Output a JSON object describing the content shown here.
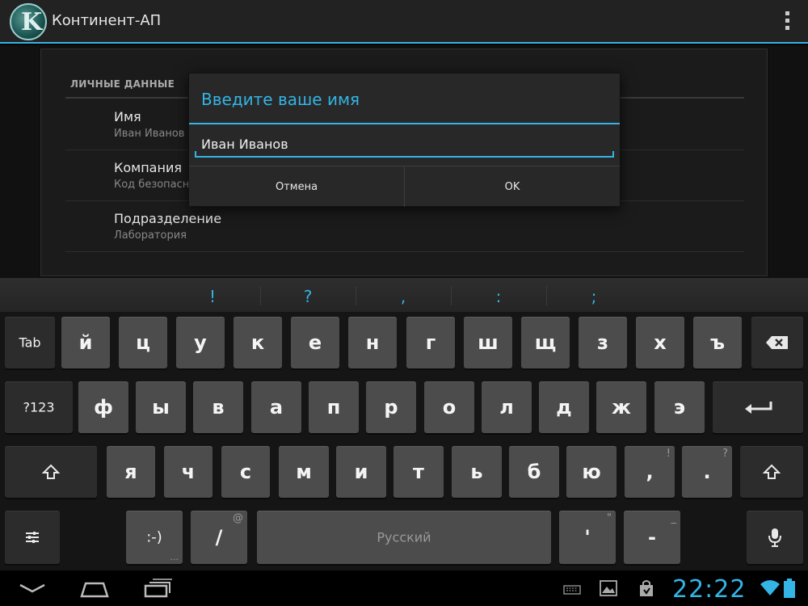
{
  "app": {
    "title": "Континент-АП",
    "icon_letter": "K"
  },
  "settings": {
    "section_header": "ЛИЧНЫЕ ДАННЫЕ",
    "items": [
      {
        "title": "Имя",
        "summary": "Иван Иванов"
      },
      {
        "title": "Компания",
        "summary": "Код безопасности"
      },
      {
        "title": "Подразделение",
        "summary": "Лаборатория"
      }
    ]
  },
  "dialog": {
    "title": "Введите ваше имя",
    "input_value": "Иван Иванов",
    "cancel_label": "Отмена",
    "ok_label": "OK"
  },
  "keyboard": {
    "suggestions": [
      "!",
      "?",
      ",",
      ":",
      ";"
    ],
    "row1": [
      "й",
      "ц",
      "у",
      "к",
      "е",
      "н",
      "г",
      "ш",
      "щ",
      "з",
      "х",
      "ъ"
    ],
    "row2": [
      "ф",
      "ы",
      "в",
      "а",
      "п",
      "р",
      "о",
      "л",
      "д",
      "ж",
      "э"
    ],
    "row3": [
      "я",
      "ч",
      "с",
      "м",
      "и",
      "т",
      "ь",
      "б",
      "ю"
    ],
    "tab_label": "Tab",
    "symbols_label": "?123",
    "comma": ",",
    "comma_hint": "!",
    "period": ".",
    "period_hint": "?",
    "smiley": ":-)",
    "smiley_hint": "...",
    "slash": "/",
    "slash_hint": "@",
    "space_label": "Русский",
    "apostrophe": "'",
    "apostrophe_hint": "\"",
    "dash": "-",
    "dash_hint": "_"
  },
  "status": {
    "clock": "22:22"
  },
  "colors": {
    "accent": "#33b5e5",
    "key_bg": "#4c4c4c",
    "func_key_bg": "#2c2c2c"
  }
}
